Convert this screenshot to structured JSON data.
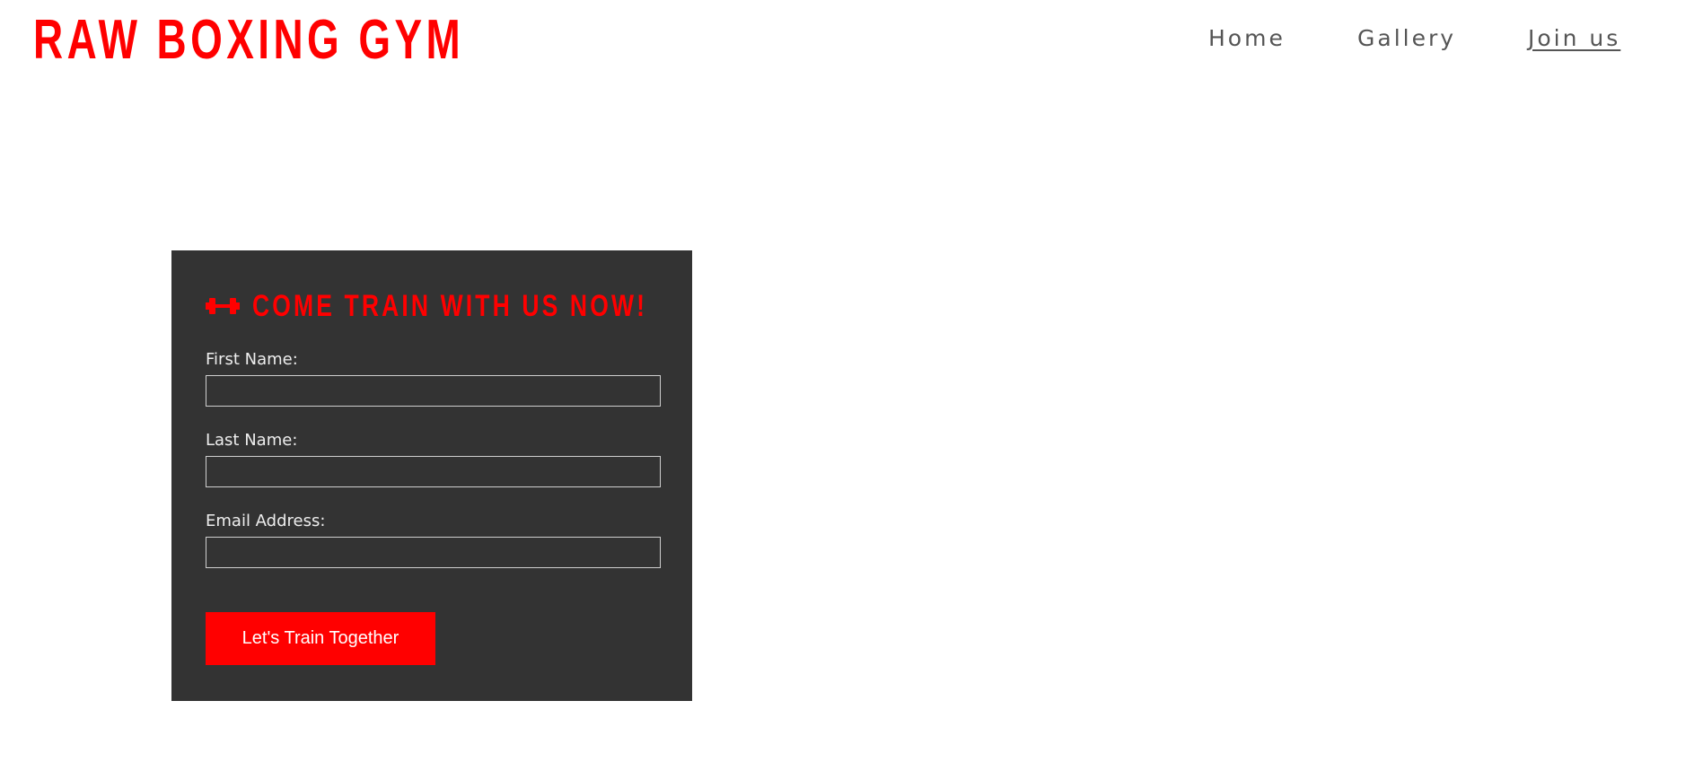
{
  "header": {
    "brand": "RAW BOXING GYM",
    "nav": [
      {
        "label": "Home",
        "active": false
      },
      {
        "label": "Gallery",
        "active": false
      },
      {
        "label": "Join us",
        "active": true
      }
    ]
  },
  "form": {
    "heading_icon": "dumbbell-icon",
    "heading": "COME TRAIN WITH US NOW!",
    "fields": {
      "first_name": {
        "label": "First Name:",
        "value": "",
        "placeholder": ""
      },
      "last_name": {
        "label": "Last Name:",
        "value": "",
        "placeholder": ""
      },
      "email": {
        "label": "Email Address:",
        "value": "",
        "placeholder": ""
      }
    },
    "submit_label": "Let's Train Together"
  },
  "colors": {
    "accent": "#ff0000",
    "card_background": "#333333",
    "nav_text": "#555555",
    "label_text": "#eeeeee"
  }
}
